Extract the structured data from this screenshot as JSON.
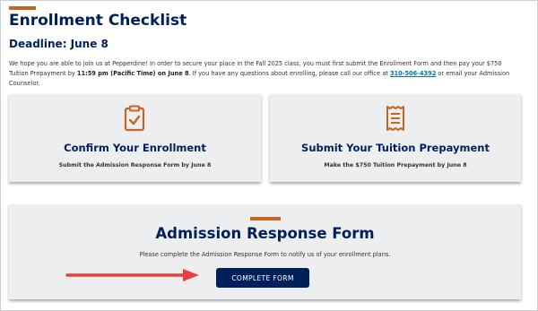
{
  "header": {
    "title": "Enrollment Checklist",
    "deadline": "Deadline: June 8"
  },
  "intro": {
    "part1": "We hope you are able to join us at Pepperdine! In order to secure your place in the Fall 2025 class, you must first submit the Enrollment Form and then pay your $750 Tuition Prepayment by ",
    "bold_deadline": "11:59 pm (Pacific Time) on June 8",
    "part2": ". If you have any questions about enrolling, please call our office at ",
    "phone": "310-506-4392",
    "part3": " or email your Admission Counselor."
  },
  "cards": [
    {
      "icon": "clipboard-check-icon",
      "title": "Confirm Your Enrollment",
      "subtitle": "Submit the Admission Response Form by June 8"
    },
    {
      "icon": "receipt-icon",
      "title": "Submit Your Tuition Prepayment",
      "subtitle": "Make the $750 Tuition Prepayment by June 8"
    }
  ],
  "response_form": {
    "title": "Admission Response Form",
    "description": "Please complete the Admission Response Form to notify us of your enrollment plans.",
    "button_label": "COMPLETE FORM"
  },
  "colors": {
    "navy": "#00205b",
    "accent_orange": "#c4661f",
    "card_bg": "#eceeef",
    "link_blue": "#0076c0",
    "arrow_red": "#e8403a"
  }
}
